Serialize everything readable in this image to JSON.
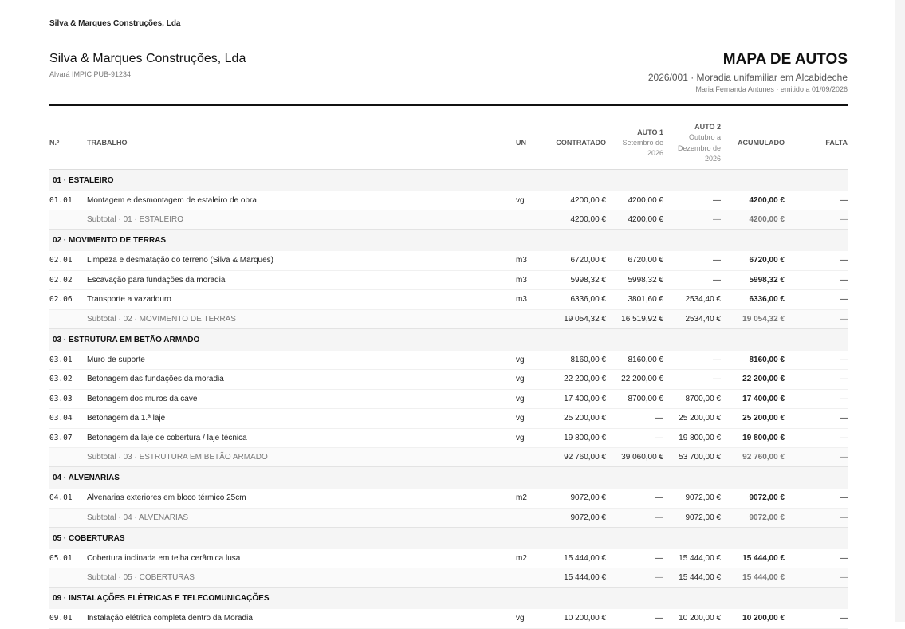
{
  "header": {
    "topline": "Silva & Marques Construções, Lda",
    "company": "Silva & Marques Construções, Lda",
    "license": "Alvará IMPIC PUB-91234",
    "title": "MAPA DE AUTOS",
    "subtitle": "2026/001 · Moradia unifamiliar em Alcabideche",
    "meta": "Maria Fernanda Antunes · emitido a 01/09/2026"
  },
  "columns": {
    "no": "N.º",
    "work": "TRABALHO",
    "un": "UN",
    "contracted": "CONTRATADO",
    "auto1": "AUTO 1",
    "auto1_period_a": "Setembro de",
    "auto1_period_b": "2026",
    "auto2": "AUTO 2",
    "auto2_period_a": "Outubro a",
    "auto2_period_b": "Dezembro de",
    "auto2_period_c": "2026",
    "accumulated": "ACUMULADO",
    "missing": "FALTA"
  },
  "sections": [
    {
      "title": "01 · ESTALEIRO",
      "items": [
        {
          "code": "01.01",
          "desc": "Montagem e desmontagem de estaleiro de obra",
          "un": "vg",
          "contracted": "4200,00 €",
          "auto1": "4200,00 €",
          "auto2": "—",
          "acc": "4200,00 €",
          "missing": "—"
        }
      ],
      "subtotal": {
        "label": "Subtotal · 01 · ESTALEIRO",
        "contracted": "4200,00 €",
        "auto1": "4200,00 €",
        "auto2": "—",
        "acc": "4200,00 €",
        "missing": "—"
      }
    },
    {
      "title": "02 · MOVIMENTO DE TERRAS",
      "items": [
        {
          "code": "02.01",
          "desc": "Limpeza e desmatação do terreno (Silva & Marques)",
          "un": "m3",
          "contracted": "6720,00 €",
          "auto1": "6720,00 €",
          "auto2": "—",
          "acc": "6720,00 €",
          "missing": "—"
        },
        {
          "code": "02.02",
          "desc": "Escavação para fundações da moradia",
          "un": "m3",
          "contracted": "5998,32 €",
          "auto1": "5998,32 €",
          "auto2": "—",
          "acc": "5998,32 €",
          "missing": "—"
        },
        {
          "code": "02.06",
          "desc": "Transporte a vazadouro",
          "un": "m3",
          "contracted": "6336,00 €",
          "auto1": "3801,60 €",
          "auto2": "2534,40 €",
          "acc": "6336,00 €",
          "missing": "—"
        }
      ],
      "subtotal": {
        "label": "Subtotal · 02 · MOVIMENTO DE TERRAS",
        "contracted": "19 054,32 €",
        "auto1": "16 519,92 €",
        "auto2": "2534,40 €",
        "acc": "19 054,32 €",
        "missing": "—"
      }
    },
    {
      "title": "03 · ESTRUTURA EM BETÃO ARMADO",
      "items": [
        {
          "code": "03.01",
          "desc": "Muro de suporte",
          "un": "vg",
          "contracted": "8160,00 €",
          "auto1": "8160,00 €",
          "auto2": "—",
          "acc": "8160,00 €",
          "missing": "—"
        },
        {
          "code": "03.02",
          "desc": "Betonagem das fundações da moradia",
          "un": "vg",
          "contracted": "22 200,00 €",
          "auto1": "22 200,00 €",
          "auto2": "—",
          "acc": "22 200,00 €",
          "missing": "—"
        },
        {
          "code": "03.03",
          "desc": "Betonagem dos muros da cave",
          "un": "vg",
          "contracted": "17 400,00 €",
          "auto1": "8700,00 €",
          "auto2": "8700,00 €",
          "acc": "17 400,00 €",
          "missing": "—"
        },
        {
          "code": "03.04",
          "desc": "Betonagem da 1.ª laje",
          "un": "vg",
          "contracted": "25 200,00 €",
          "auto1": "—",
          "auto2": "25 200,00 €",
          "acc": "25 200,00 €",
          "missing": "—"
        },
        {
          "code": "03.07",
          "desc": "Betonagem da laje de cobertura / laje técnica",
          "un": "vg",
          "contracted": "19 800,00 €",
          "auto1": "—",
          "auto2": "19 800,00 €",
          "acc": "19 800,00 €",
          "missing": "—"
        }
      ],
      "subtotal": {
        "label": "Subtotal · 03 · ESTRUTURA EM BETÃO ARMADO",
        "contracted": "92 760,00 €",
        "auto1": "39 060,00 €",
        "auto2": "53 700,00 €",
        "acc": "92 760,00 €",
        "missing": "—"
      }
    },
    {
      "title": "04 · ALVENARIAS",
      "items": [
        {
          "code": "04.01",
          "desc": "Alvenarias exteriores em bloco térmico 25cm",
          "un": "m2",
          "contracted": "9072,00 €",
          "auto1": "—",
          "auto2": "9072,00 €",
          "acc": "9072,00 €",
          "missing": "—"
        }
      ],
      "subtotal": {
        "label": "Subtotal · 04 · ALVENARIAS",
        "contracted": "9072,00 €",
        "auto1": "—",
        "auto2": "9072,00 €",
        "acc": "9072,00 €",
        "missing": "—"
      }
    },
    {
      "title": "05 · COBERTURAS",
      "items": [
        {
          "code": "05.01",
          "desc": "Cobertura inclinada em telha cerâmica lusa",
          "un": "m2",
          "contracted": "15 444,00 €",
          "auto1": "—",
          "auto2": "15 444,00 €",
          "acc": "15 444,00 €",
          "missing": "—"
        }
      ],
      "subtotal": {
        "label": "Subtotal · 05 · COBERTURAS",
        "contracted": "15 444,00 €",
        "auto1": "—",
        "auto2": "15 444,00 €",
        "acc": "15 444,00 €",
        "missing": "—"
      }
    },
    {
      "title": "09 · INSTALAÇÕES ELÉTRICAS E TELECOMUNICAÇÕES",
      "items": [
        {
          "code": "09.01",
          "desc": "Instalação elétrica completa dentro da Moradia",
          "un": "vg",
          "contracted": "10 200,00 €",
          "auto1": "—",
          "auto2": "10 200,00 €",
          "acc": "10 200,00 €",
          "missing": "—"
        }
      ]
    }
  ]
}
